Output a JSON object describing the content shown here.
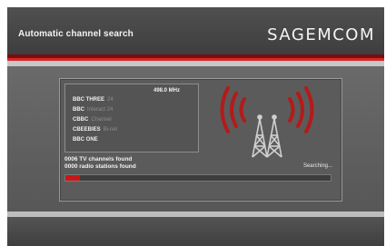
{
  "header": {
    "title": "Automatic channel search",
    "brand": "SAGEMCOM"
  },
  "scan": {
    "frequency": "498.0 MHz",
    "channels": [
      {
        "name": "BBC THREE",
        "suffix": "24"
      },
      {
        "name": "BBC",
        "suffix": "Interact 24"
      },
      {
        "name": "CBBC",
        "suffix": "Channel"
      },
      {
        "name": "CBEEBIES",
        "suffix": "Bi-nel"
      },
      {
        "name": "BBC ONE",
        "suffix": ""
      }
    ],
    "tv_found": "0006 TV channels found",
    "radio_found": "0000 radio stations found",
    "status": "Searching...",
    "progress": 0.055
  },
  "colors": {
    "accent": "#c81616",
    "signal_waves": "#b41a1a",
    "tower": "#d0d0d0"
  },
  "icons": {
    "tower": "broadcast-tower-icon",
    "waves": "signal-waves-icon"
  }
}
